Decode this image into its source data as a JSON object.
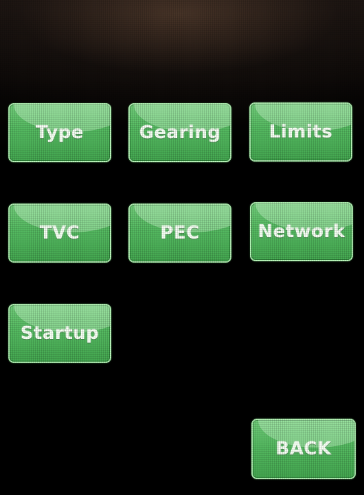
{
  "menu": {
    "buttons": [
      {
        "label": "Type"
      },
      {
        "label": "Gearing"
      },
      {
        "label": "Limits"
      },
      {
        "label": "TVC"
      },
      {
        "label": "PEC"
      },
      {
        "label": "Network"
      },
      {
        "label": "Startup"
      }
    ]
  },
  "footer": {
    "back_label": "BACK"
  },
  "colors": {
    "button_fill": "#54b860",
    "button_border": "#a6e3a8",
    "button_text": "#f4fff2",
    "background": "#000000"
  }
}
